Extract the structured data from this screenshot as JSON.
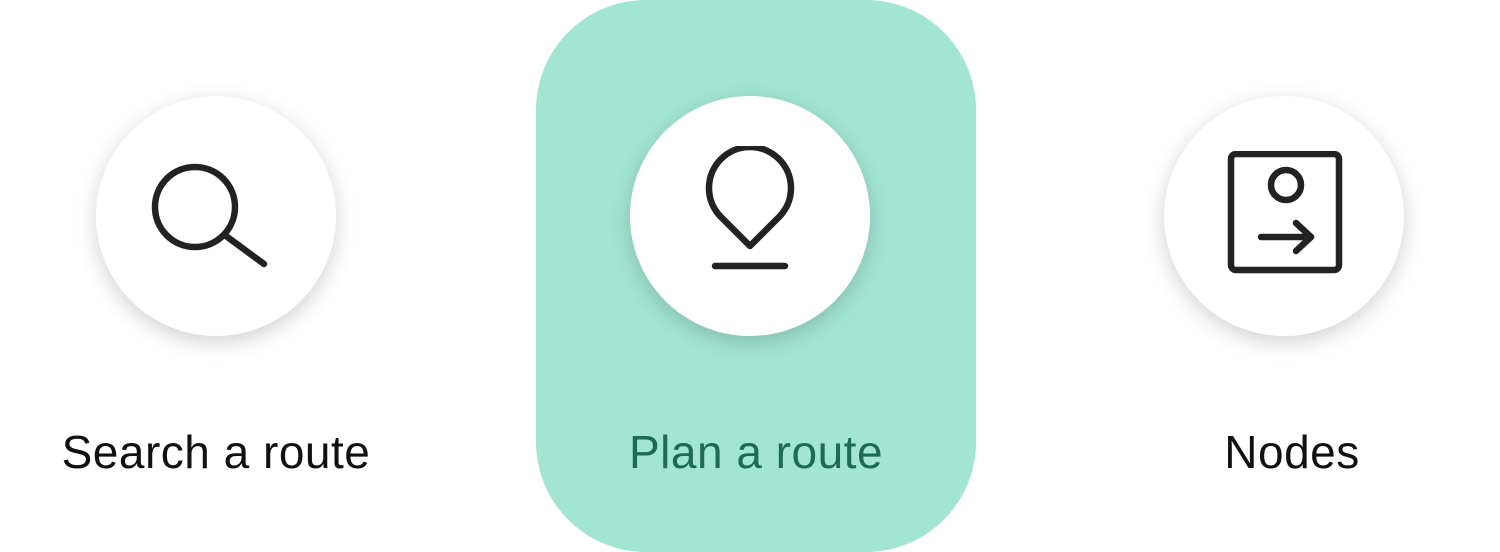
{
  "colors": {
    "active_background": "#a2e5d3",
    "active_label": "#1f6b52",
    "inactive_label": "#111111",
    "icon_stroke": "#222222"
  },
  "nav": {
    "items": [
      {
        "label": "Search a route",
        "icon": "search-icon",
        "active": false
      },
      {
        "label": "Plan a route",
        "icon": "map-pin-icon",
        "active": true
      },
      {
        "label": "Nodes",
        "icon": "node-exit-icon",
        "active": false
      }
    ]
  }
}
